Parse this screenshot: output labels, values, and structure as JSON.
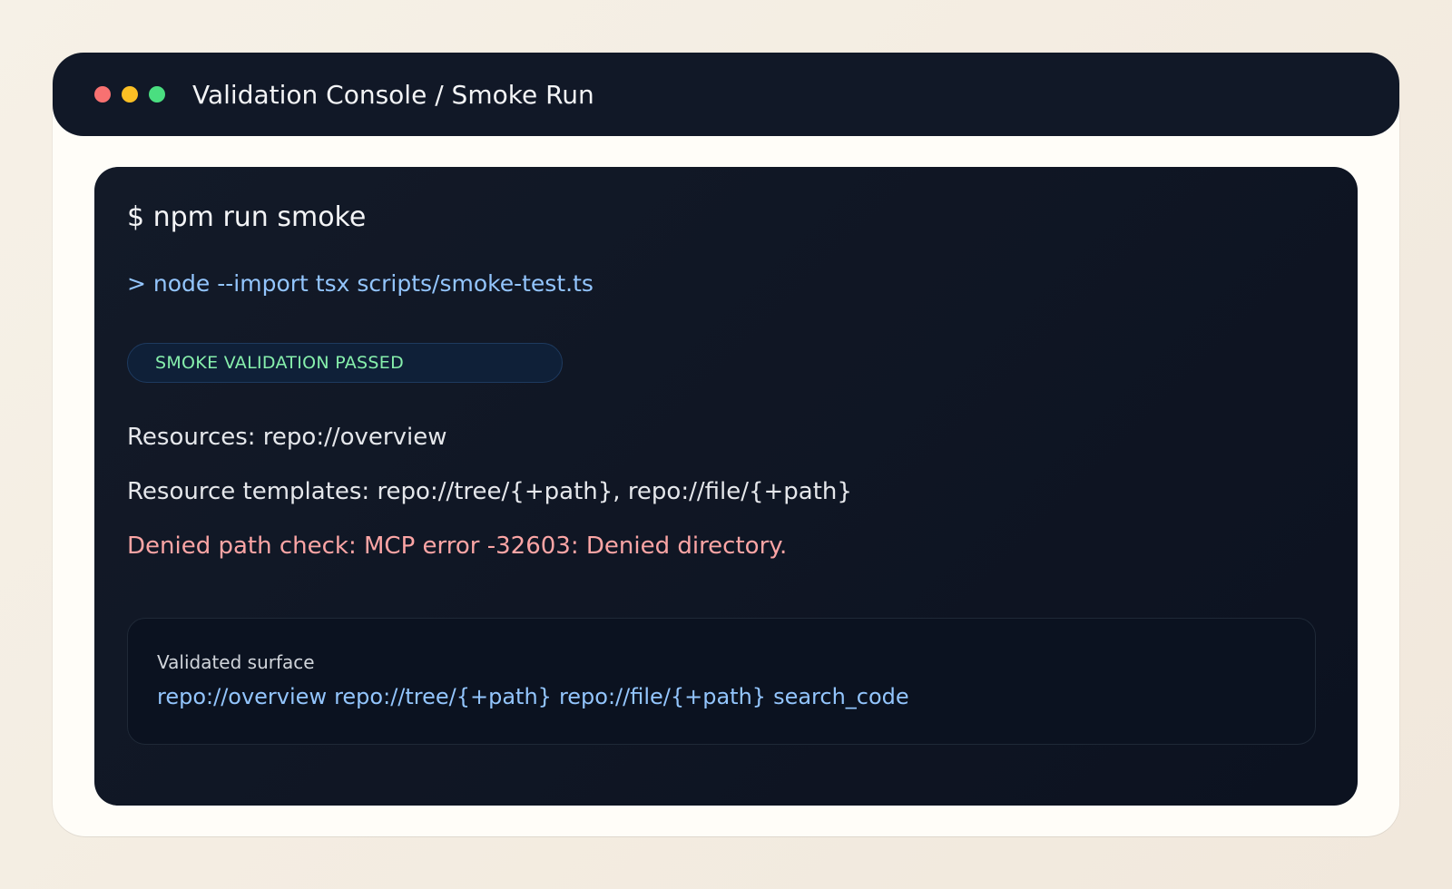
{
  "window": {
    "title": "Validation Console / Smoke Run",
    "controls": [
      "close",
      "minimize",
      "maximize"
    ]
  },
  "terminal": {
    "command": "$ npm run smoke",
    "subcommand": "> node --import tsx scripts/smoke-test.ts",
    "status_badge": "SMOKE VALIDATION PASSED",
    "resources_line": "Resources: repo://overview",
    "templates_line": "Resource templates: repo://tree/{+path}, repo://file/{+path}",
    "error_line": "Denied path check: MCP error -32603: Denied directory."
  },
  "surface": {
    "label": "Validated surface",
    "items": [
      "repo://overview",
      "repo://tree/{+path}",
      "repo://file/{+path}",
      "search_code"
    ]
  },
  "colors": {
    "close": "#f87171",
    "minimize": "#fbbf24",
    "maximize": "#4ade80",
    "success": "#86efac",
    "error": "#fca5a5",
    "link": "#93c5fd"
  }
}
